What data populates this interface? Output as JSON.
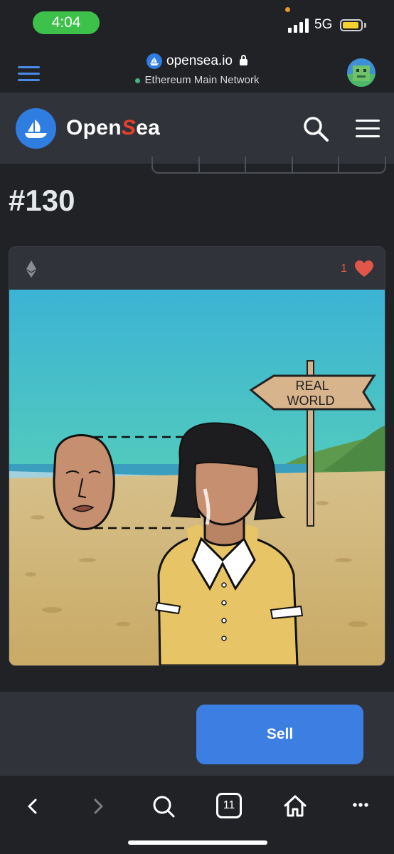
{
  "status_bar": {
    "time": "4:04",
    "network": "5G",
    "colors": {
      "time_pill": "#3ec14a",
      "battery": "#f3d230"
    }
  },
  "browser": {
    "url": "opensea.io",
    "network_label": "Ethereum Main Network",
    "icons": [
      "hamburger-icon",
      "lock-icon",
      "avatar"
    ]
  },
  "header": {
    "brand_prefix": "Open",
    "brand_accent": "S",
    "brand_suffix": "ea",
    "accent_color": "#2f7de1",
    "icons": [
      "search-icon",
      "menu-icon"
    ]
  },
  "item": {
    "title": "#130",
    "favorites_count": "1",
    "sign_text": "REAL WORLD",
    "sign_line1": "REAL",
    "sign_line2": "WORLD"
  },
  "actions": {
    "sell_label": "Sell",
    "sell_color": "#3c7ee1"
  },
  "toolbar": {
    "tabs_count": "11",
    "icons": [
      "back-icon",
      "forward-icon",
      "search-icon",
      "tabs-icon",
      "home-icon",
      "more-icon"
    ]
  }
}
